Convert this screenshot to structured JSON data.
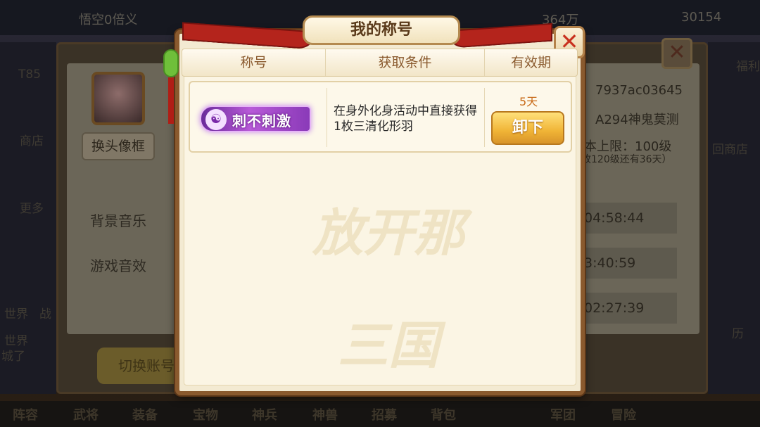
{
  "background": {
    "top_left_text": "悟空0倍义",
    "top_gold": "364万",
    "top_gems": "30154",
    "left_level": "T85",
    "left_shop": "商店",
    "left_more": "更多",
    "change_avatar": "换头像框",
    "bg_music": "背景音乐",
    "game_sfx": "游戏音效",
    "switch_account": "切换账号",
    "right_id": "7937ac03645",
    "right_server": "A294神鬼莫测",
    "right_level_cap": "本上限：100级",
    "right_level_note": "收120级还有36天）",
    "right_times": [
      "04:58:44",
      "3:40:59",
      "02:27:39"
    ],
    "right_label_1": "福利",
    "right_label_2": "回商店",
    "right_label_3": "历",
    "chat_tags": [
      "世界",
      "世界"
    ],
    "chat_texts": [
      "战",
      "城了"
    ],
    "bottom_tabs": [
      "阵容",
      "武将",
      "装备",
      "宝物",
      "神兵",
      "神兽",
      "招募",
      "背包",
      "军团",
      "冒险"
    ]
  },
  "dialog": {
    "title": "我的称号",
    "close_glyph": "✕",
    "headers": [
      "称号",
      "获取条件",
      "有效期"
    ],
    "watermark": "放开那三国",
    "row": {
      "badge_icon": "☯",
      "badge_text": "刺不刺激",
      "condition": "在身外化身活动中直接获得1枚三清化形羽",
      "expire": "5天",
      "button": "卸下"
    }
  },
  "colors": {
    "dialog_border": "#8a5a2e",
    "ribbon": "#b4241c",
    "badge": "#b85ad8",
    "button": "#f0b436",
    "close": "#c8301e"
  }
}
